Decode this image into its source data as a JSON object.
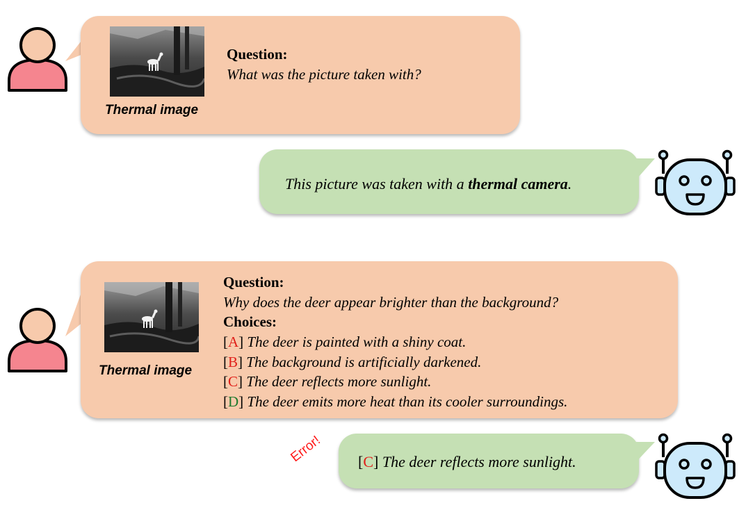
{
  "exchange1": {
    "image_caption": "Thermal image",
    "question_label": "Question:",
    "question_text": "What was the picture taken with?",
    "answer_prefix": "This picture was taken with a ",
    "answer_bold": "thermal camera",
    "answer_suffix": "."
  },
  "exchange2": {
    "image_caption": "Thermal image",
    "question_label": "Question:",
    "question_text": "Why does the deer appear brighter than the background?",
    "choices_label": "Choices:",
    "choices": [
      {
        "letter": "A",
        "text": "The deer is painted with a shiny coat.",
        "color": "#e0201a"
      },
      {
        "letter": "B",
        "text": "The background is artificially darkened.",
        "color": "#e0201a"
      },
      {
        "letter": "C",
        "text": "The deer reflects more sunlight.",
        "color": "#e0201a"
      },
      {
        "letter": "D",
        "text": "The deer emits more heat than its cooler surroundings.",
        "color": "#1f7a2e"
      }
    ],
    "answer_letter": "C",
    "answer_text": "The deer reflects more sunlight.",
    "error_label": "Error!"
  },
  "colors": {
    "user_bubble": "#f7caac",
    "bot_bubble": "#c5e0b4",
    "user_avatar": "#f5858f",
    "user_head": "#f7caac",
    "robot_face": "#cdeafb",
    "wrong_letter": "#e0201a",
    "correct_letter": "#1f7a2e"
  },
  "icons": [
    "user-avatar-icon",
    "robot-avatar-icon",
    "bubble-tail"
  ]
}
